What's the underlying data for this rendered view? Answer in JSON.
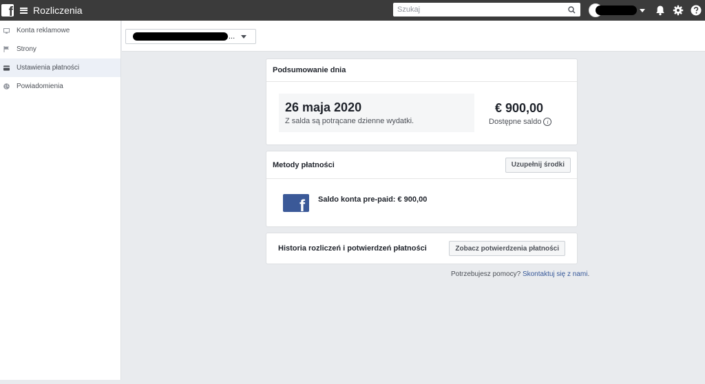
{
  "app": {
    "title": "Rozliczenia"
  },
  "search": {
    "placeholder": "Szukaj"
  },
  "sidebar": {
    "items": [
      {
        "label": "Konta reklamowe",
        "icon": "monitor-icon"
      },
      {
        "label": "Strony",
        "icon": "flag-icon"
      },
      {
        "label": "Ustawienia płatności",
        "icon": "card-icon",
        "active": true
      },
      {
        "label": "Powiadomienia",
        "icon": "globe-icon"
      }
    ]
  },
  "account": {
    "ellipsis": "..."
  },
  "summary": {
    "title": "Podsumowanie dnia",
    "date": "26 maja 2020",
    "note": "Z salda są potrącane dzienne wydatki.",
    "balance": "€ 900,00",
    "balance_label": "Dostępne saldo",
    "info_glyph": "i"
  },
  "payment_methods": {
    "title": "Metody płatności",
    "topup_button": "Uzupełnij środki",
    "prepaid_label": "Saldo konta pre-paid: € 900,00"
  },
  "history": {
    "title": "Historia rozliczeń i potwierdzeń płatności",
    "button": "Zobacz potwierdzenia płatności"
  },
  "help": {
    "question": "Potrzebujesz pomocy?",
    "link": "Skontaktuj się z nami",
    "suffix": "."
  },
  "colors": {
    "topbar": "#3b3b3b",
    "facebook_blue": "#3b5998",
    "link": "#365899",
    "background": "#e9ebee"
  }
}
